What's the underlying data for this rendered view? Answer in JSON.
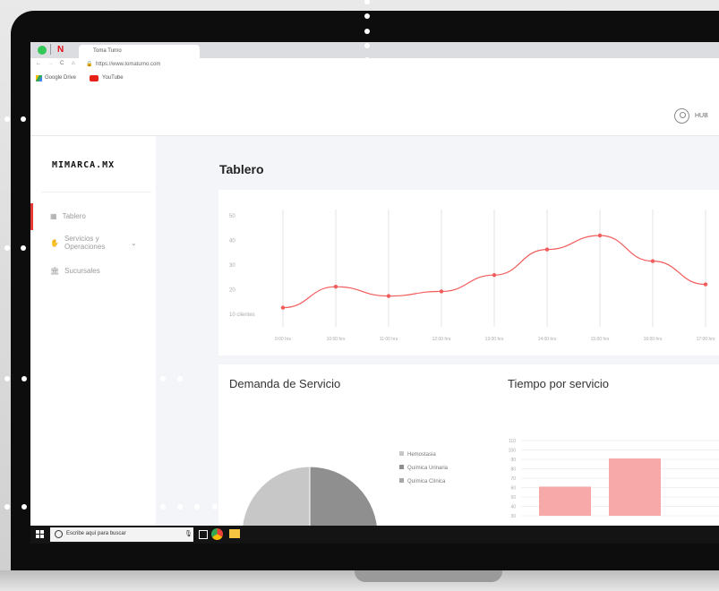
{
  "browser": {
    "tab_title": "Toma Turno",
    "url": "https://www.tomaturno.com",
    "bookmarks": [
      {
        "label": "Google Drive",
        "icon": "google-drive-icon"
      },
      {
        "label": "YouTube",
        "icon": "youtube-icon"
      }
    ]
  },
  "header": {
    "user_name": "HUB"
  },
  "sidebar": {
    "logo": "MIMARCA.MX",
    "items": [
      {
        "label": "Tablero",
        "icon": "grid-icon",
        "active": true
      },
      {
        "label": "Servicios y Operaciones",
        "icon": "hand-icon",
        "active": false
      },
      {
        "label": "Sucursales",
        "icon": "bank-icon",
        "active": false
      }
    ]
  },
  "main": {
    "page_title": "Tablero",
    "demand_title": "Demanda de Servicio",
    "time_title": "Tiempo por servicio"
  },
  "chart_data": [
    {
      "type": "line",
      "x": [
        "9:00 hrs",
        "10:00 hrs",
        "11:00 hrs",
        "12:00 hrs",
        "13:00 hrs",
        "14:00 hrs",
        "15:00 hrs",
        "16:00 hrs",
        "17:00 hrs"
      ],
      "y_ticks": [
        "50",
        "40",
        "30",
        "20",
        "10 clientes"
      ],
      "series": [
        {
          "values": [
            9,
            18,
            14,
            16,
            23,
            34,
            40,
            29,
            19
          ]
        }
      ],
      "ylim": [
        0,
        50
      ],
      "grid": "vertical",
      "color": "#f25c5c"
    },
    {
      "type": "pie",
      "legend": [
        "Hemostasia",
        "Química Urinaria",
        "Química Clínica"
      ],
      "colors": [
        "#c7c7c7",
        "#8f8f8f",
        "#a8a8a8"
      ],
      "values": [
        50,
        50
      ]
    },
    {
      "type": "bar",
      "y_ticks": [
        "110",
        "100",
        "90",
        "80",
        "70",
        "60",
        "50",
        "40",
        "30"
      ],
      "ylim": [
        30,
        110
      ],
      "values": [
        61,
        91
      ],
      "color": "#f7a8a8"
    }
  ],
  "taskbar": {
    "search_placeholder": "Escribe aquí para buscar"
  }
}
